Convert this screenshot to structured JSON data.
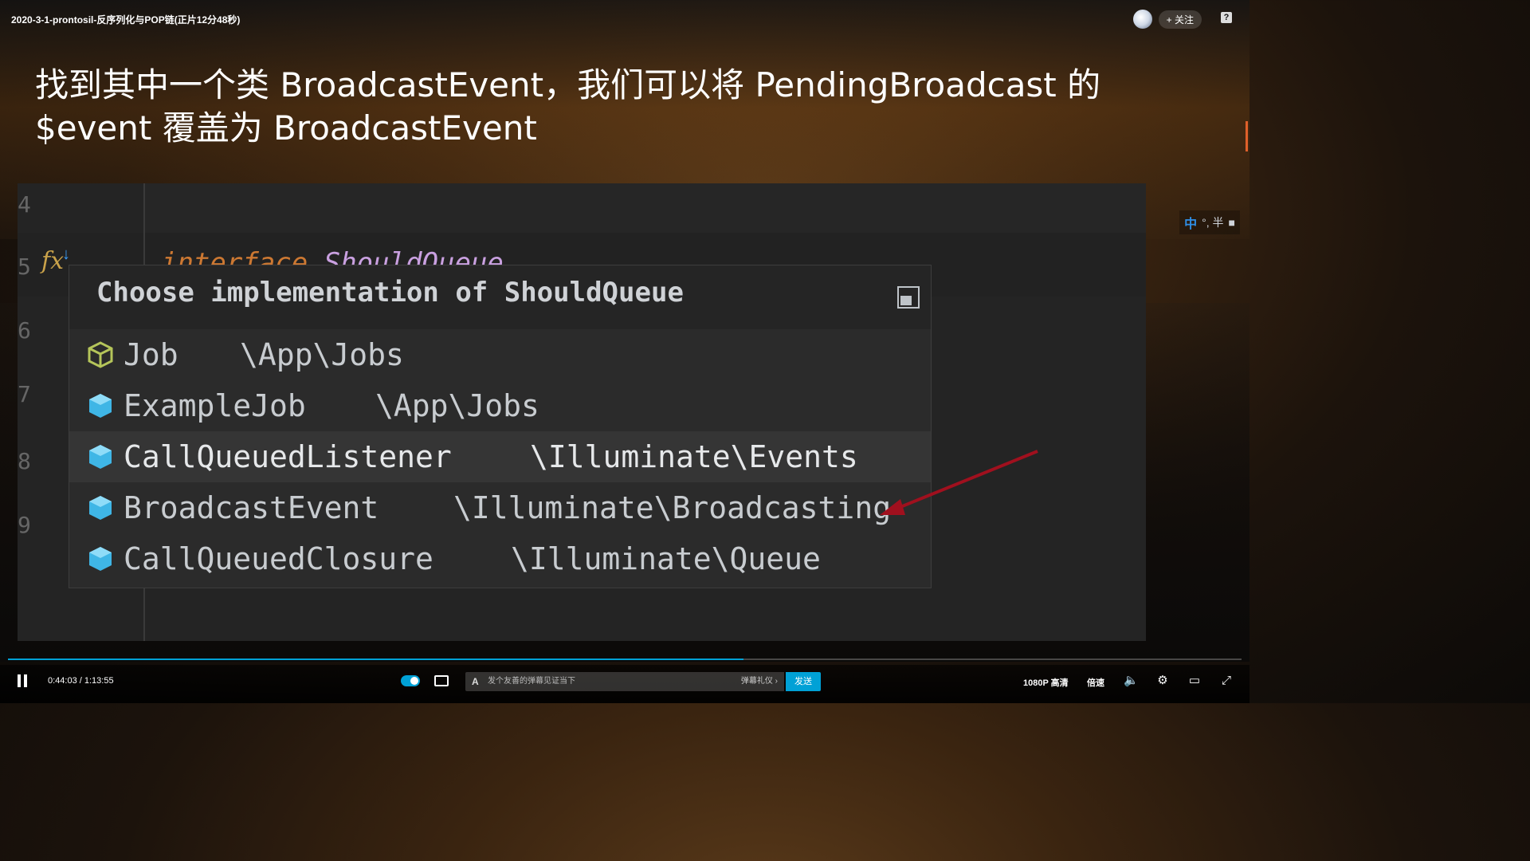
{
  "video": {
    "title": "2020-3-1-prontosil-反序列化与POP链(正片12分48秒)"
  },
  "uploader": {
    "follow_label": "+ 关注"
  },
  "slide": {
    "heading": "找到其中一个类 BroadcastEvent，我们可以将 PendingBroadcast 的 $event 覆盖为 BroadcastEvent"
  },
  "ime": {
    "mode_label": "中",
    "rest_label": "°, 半"
  },
  "editor": {
    "line_numbers": [
      "4",
      "5",
      "6",
      "7",
      "8",
      "9"
    ],
    "peek_keyword": "interface",
    "peek_name": "ShouldQueue",
    "popup": {
      "title": "Choose implementation of ShouldQueue",
      "items": [
        {
          "name": "Job",
          "namespace": "\\App\\Jobs",
          "icon": "outline-cube-icon",
          "selected": false
        },
        {
          "name": "ExampleJob",
          "namespace": "\\App\\Jobs",
          "icon": "class-cube-icon",
          "selected": false
        },
        {
          "name": "CallQueuedListener",
          "namespace": "\\Illuminate\\Events",
          "icon": "class-cube-icon",
          "selected": true
        },
        {
          "name": "BroadcastEvent",
          "namespace": "\\Illuminate\\Broadcasting",
          "icon": "class-cube-icon",
          "selected": false
        },
        {
          "name": "CallQueuedClosure",
          "namespace": "\\Illuminate\\Queue",
          "icon": "class-cube-icon",
          "selected": false
        }
      ]
    },
    "annotation_color": "#a0101e"
  },
  "player": {
    "current_time": "0:44:03",
    "duration": "1:13:55",
    "time_display": "0:44:03 / 1:13:55",
    "progress_fraction": 0.596,
    "danmaku_placeholder": "发个友善的弹幕见证当下",
    "danmaku_etiquette": "弹幕礼仪 ›",
    "send_label": "发送",
    "quality_label": "1080P 高清",
    "speed_label": "倍速",
    "accent_color": "#00a1d6"
  }
}
